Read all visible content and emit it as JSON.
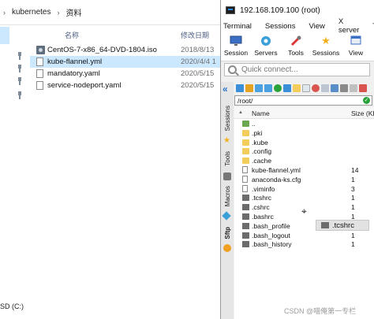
{
  "explorer": {
    "breadcrumb": [
      "kubernetes",
      "资料"
    ],
    "columns": {
      "name": "名称",
      "date": "修改日期"
    },
    "files": [
      {
        "name": "CentOS-7-x86_64-DVD-1804.iso",
        "date": "2018/8/13",
        "icon": "iso-file-icon",
        "selected": false
      },
      {
        "name": "kube-flannel.yml",
        "date": "2020/4/4 1",
        "icon": "text-file-icon",
        "selected": true
      },
      {
        "name": "mandatory.yaml",
        "date": "2020/5/15",
        "icon": "text-file-icon",
        "selected": false
      },
      {
        "name": "service-nodeport.yaml",
        "date": "2020/5/15",
        "icon": "text-file-icon",
        "selected": false
      }
    ],
    "drive_label": "SD (C:)"
  },
  "moba": {
    "title": "192.168.109.100 (root)",
    "menu": [
      "Terminal",
      "Sessions",
      "View",
      "X server",
      "T"
    ],
    "tools": [
      {
        "label": "Session",
        "icon": "monitor-icon"
      },
      {
        "label": "Servers",
        "icon": "servers-icon"
      },
      {
        "label": "Tools",
        "icon": "tools-icon"
      },
      {
        "label": "Sessions",
        "icon": "star-icon"
      },
      {
        "label": "View",
        "icon": "view-icon"
      }
    ],
    "quick_connect_placeholder": "Quick connect...",
    "side_tabs": [
      "Sessions",
      "Tools",
      "Macros",
      "Sftp"
    ],
    "sftp": {
      "path": "/root/",
      "columns": {
        "name": "Name",
        "size": "Size (KB"
      },
      "rows": [
        {
          "name": "..",
          "size": "",
          "kind": "up"
        },
        {
          "name": ".pki",
          "size": "",
          "kind": "folder"
        },
        {
          "name": ".kube",
          "size": "",
          "kind": "folder"
        },
        {
          "name": ".config",
          "size": "",
          "kind": "folder"
        },
        {
          "name": ".cache",
          "size": "",
          "kind": "folder"
        },
        {
          "name": "kube-flannel.yml",
          "size": "14",
          "kind": "file"
        },
        {
          "name": "anaconda-ks.cfg",
          "size": "1",
          "kind": "file"
        },
        {
          "name": ".viminfo",
          "size": "3",
          "kind": "file"
        },
        {
          "name": ".tcshrc",
          "size": "1",
          "kind": "hidden"
        },
        {
          "name": ".cshrc",
          "size": "1",
          "kind": "hidden"
        },
        {
          "name": ".bashrc",
          "size": "1",
          "kind": "hidden"
        },
        {
          "name": ".bash_profile",
          "size": "1",
          "kind": "hidden"
        },
        {
          "name": ".bash_logout",
          "size": "1",
          "kind": "hidden"
        },
        {
          "name": ".bash_history",
          "size": "1",
          "kind": "hidden"
        }
      ]
    },
    "drag_ghost_label": ".tcshrc"
  },
  "watermark": "CSDN @喵俺第一专栏",
  "colors": {
    "selection": "#cce8ff",
    "accent_blue": "#2673c9",
    "folder": "#f2cd5c"
  }
}
